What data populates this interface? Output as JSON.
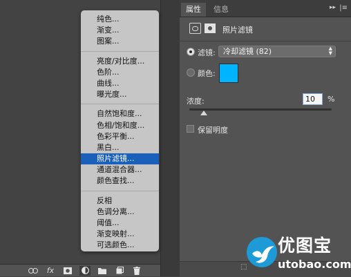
{
  "menu": {
    "groups": [
      {
        "items": [
          "纯色...",
          "渐变...",
          "图案..."
        ]
      },
      {
        "items": [
          "亮度/对比度...",
          "色阶...",
          "曲线...",
          "曝光度..."
        ]
      },
      {
        "items": [
          "自然饱和度...",
          "色相/饱和度...",
          "色彩平衡...",
          "黑白...",
          "照片滤镜...",
          "通道混合器...",
          "颜色查找..."
        ]
      },
      {
        "items": [
          "反相",
          "色调分离...",
          "阈值...",
          "渐变映射...",
          "可选颜色..."
        ]
      }
    ],
    "active_item": "照片滤镜..."
  },
  "layers_toolbar": {
    "icons": [
      "link-icon",
      "fx-icon",
      "mask-icon",
      "adjustment-layer-icon",
      "folder-icon",
      "new-layer-icon",
      "trash-icon"
    ],
    "fx_label": "fx"
  },
  "panel": {
    "tabs": {
      "properties": "属性",
      "info": "信息"
    },
    "title": "照片滤镜",
    "filter": {
      "label": "滤镜:",
      "value": "冷却滤镜 (82)",
      "selected": true
    },
    "color": {
      "label": "颜色:",
      "swatch": "#00b4ff",
      "selected": false
    },
    "density": {
      "label": "浓度:",
      "value": "10",
      "unit": "%",
      "percent": 10
    },
    "preserve_luminosity": {
      "label": "保留明度",
      "checked": false
    }
  },
  "watermark": {
    "text_cn": "优图宝",
    "text_en": "utobao.com",
    "logo_color": "#1e9bd7"
  }
}
